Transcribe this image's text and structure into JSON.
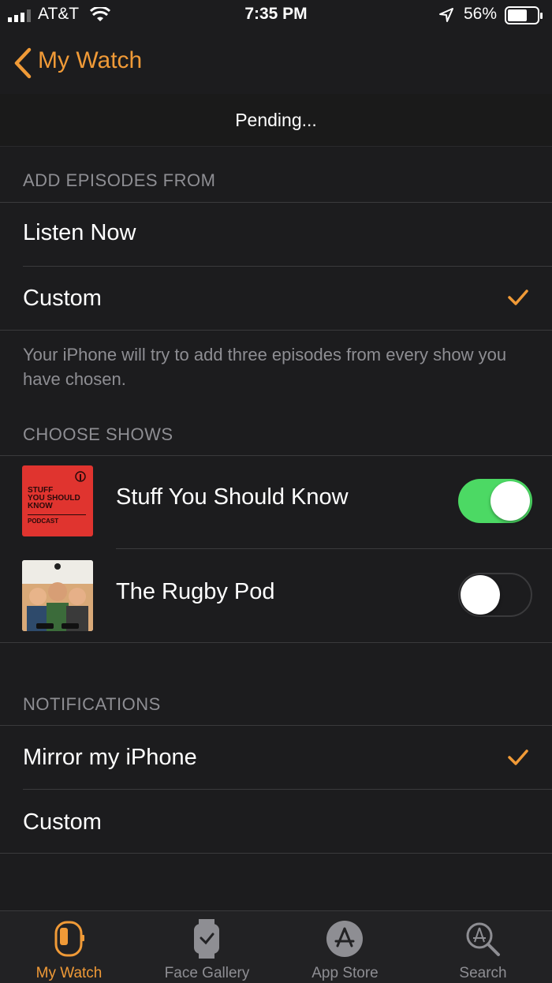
{
  "status_bar": {
    "carrier": "AT&T",
    "time": "7:35 PM",
    "battery": "56%"
  },
  "nav": {
    "back_label": "My Watch"
  },
  "pending_text": "Pending...",
  "add_episodes": {
    "header": "ADD EPISODES FROM",
    "options": [
      {
        "label": "Listen Now",
        "checked": false
      },
      {
        "label": "Custom",
        "checked": true
      }
    ],
    "note": "Your iPhone will try to add three episodes from every show you have chosen."
  },
  "choose_shows": {
    "header": "CHOOSE SHOWS",
    "shows": [
      {
        "title": "Stuff You Should Know",
        "enabled": true,
        "art_lines": [
          "STUFF",
          "YOU SHOULD",
          "KNOW"
        ],
        "art_sub": "PODCAST"
      },
      {
        "title": "The Rugby Pod",
        "enabled": false
      }
    ]
  },
  "notifications": {
    "header": "NOTIFICATIONS",
    "options": [
      {
        "label": "Mirror my iPhone",
        "checked": true
      },
      {
        "label": "Custom",
        "checked": false
      }
    ]
  },
  "tabbar": {
    "tabs": [
      {
        "label": "My Watch",
        "icon": "watch-icon",
        "active": true
      },
      {
        "label": "Face Gallery",
        "icon": "face-gallery-icon",
        "active": false
      },
      {
        "label": "App Store",
        "icon": "app-store-icon",
        "active": false
      },
      {
        "label": "Search",
        "icon": "search-icon",
        "active": false
      }
    ]
  },
  "colors": {
    "accent": "#f09a37",
    "toggle_on": "#4cd964",
    "background": "#1c1c1e"
  }
}
